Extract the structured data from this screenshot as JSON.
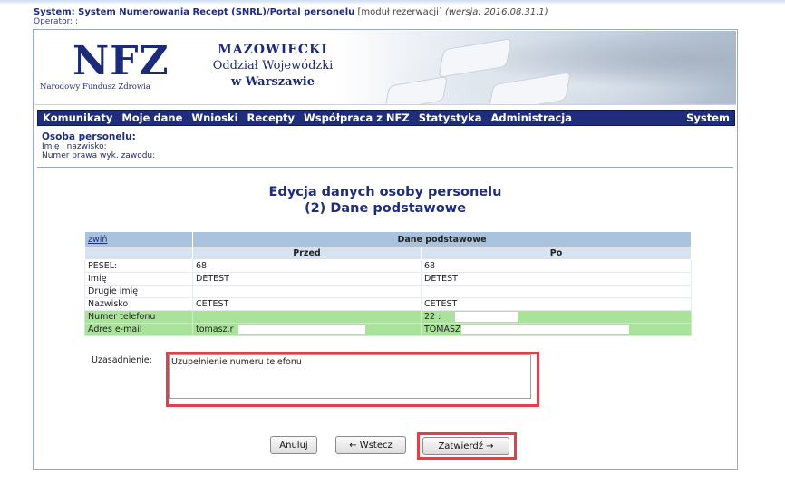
{
  "header": {
    "system_label": "System: System Numerowania Recept (SNRL)/Portal personelu",
    "module": "[moduł rezerwacji]",
    "version": "(wersja: 2016.08.31.1)",
    "operator": "Operator: :"
  },
  "banner": {
    "logo": "NFZ",
    "logo_sub": "Narodowy Fundusz Zdrowia",
    "branch_line1": "MAZOWIECKI",
    "branch_line2": "Oddział Wojewódzki",
    "branch_line3": "w Warszawie"
  },
  "menu": [
    "Komunikaty",
    "Moje dane",
    "Wnioski",
    "Recepty",
    "Współpraca z NFZ",
    "Statystyka",
    "Administracja",
    "System"
  ],
  "person": {
    "title": "Osoba personelu:",
    "name_label": "Imię i nazwisko:",
    "license_label": "Numer prawa wyk. zawodu:"
  },
  "heading": {
    "line1": "Edycja danych osoby personelu",
    "line2": "(2) Dane podstawowe"
  },
  "table": {
    "collapse_link": "zwiń",
    "title": "Dane podstawowe",
    "col_before": "Przed",
    "col_after": "Po",
    "rows": [
      {
        "label": "PESEL:",
        "before": "68",
        "after": "68"
      },
      {
        "label": "Imię",
        "before": "DETEST",
        "after": "DETEST"
      },
      {
        "label": "Drugie imię",
        "before": "",
        "after": ""
      },
      {
        "label": "Nazwisko",
        "before": "CETEST",
        "after": "CETEST"
      },
      {
        "label": "Numer telefonu",
        "before": "",
        "after": "22 :"
      },
      {
        "label": "Adres e-mail",
        "before": "tomasz.r",
        "after": "TOMASZ"
      }
    ]
  },
  "justification": {
    "label": "Uzasadnienie:",
    "value": "Uzupełnienie numeru telefonu"
  },
  "buttons": {
    "cancel": "Anuluj",
    "back": "← Wstecz",
    "confirm": "Zatwierdź →"
  }
}
